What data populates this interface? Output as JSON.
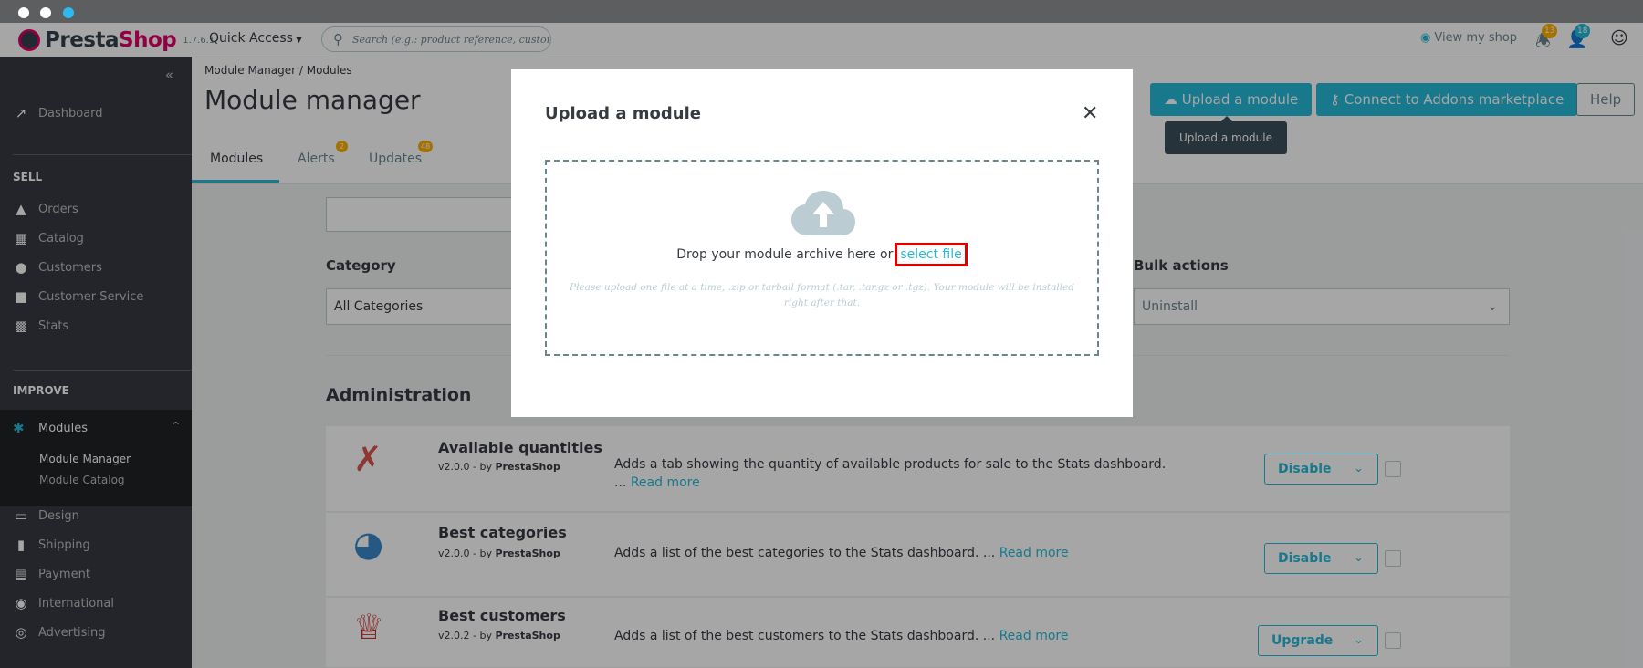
{
  "topbar": {
    "logo_name_part1": "Presta",
    "logo_name_part2": "Shop",
    "version": "1.7.6.1",
    "quick_access": "Quick Access",
    "search_placeholder": "Search (e.g.: product reference, customer name…)",
    "view_shop": "View my shop",
    "notif_orders_count": "13",
    "notif_customers_count": "18"
  },
  "sidebar": {
    "dashboard": "Dashboard",
    "sell_title": "SELL",
    "orders": "Orders",
    "catalog": "Catalog",
    "customers": "Customers",
    "customer_service": "Customer Service",
    "stats": "Stats",
    "improve_title": "IMPROVE",
    "modules": "Modules",
    "module_manager": "Module Manager",
    "module_catalog": "Module Catalog",
    "design": "Design",
    "shipping": "Shipping",
    "payment": "Payment",
    "international": "International",
    "advertising": "Advertising"
  },
  "header": {
    "breadcrumb_1": "Module Manager",
    "breadcrumb_2": "Modules",
    "title": "Module manager",
    "upload_btn": "Upload a module",
    "connect_btn": "Connect to Addons marketplace",
    "help_btn": "Help",
    "tooltip": "Upload a module",
    "tabs": [
      {
        "label": "Modules"
      },
      {
        "label": "Alerts",
        "badge": "2"
      },
      {
        "label": "Updates",
        "badge": "48"
      }
    ]
  },
  "filters": {
    "category_label": "Category",
    "category_value": "All Categories",
    "bulk_label": "Bulk actions",
    "bulk_value": "Uninstall"
  },
  "group_title": "Administration",
  "modules_list": [
    {
      "name": "Available quantities",
      "version": "v2.0.0 - by",
      "author": "PrestaShop",
      "desc": "Adds a tab showing the quantity of available products for sale to the Stats dashboard. ...",
      "read_more": "Read more",
      "action": "Disable"
    },
    {
      "name": "Best categories",
      "version": "v2.0.0 - by",
      "author": "PrestaShop",
      "desc": "Adds a list of the best categories to the Stats dashboard. ...",
      "read_more": "Read more",
      "action": "Disable"
    },
    {
      "name": "Best customers",
      "version": "v2.0.2 - by",
      "author": "PrestaShop",
      "desc": "Adds a list of the best customers to the Stats dashboard. ...",
      "read_more": "Read more",
      "action": "Upgrade"
    }
  ],
  "modal": {
    "title": "Upload a module",
    "drop_text": "Drop your module archive here or",
    "select_file": "select file",
    "hint": "Please upload one file at a time, .zip or tarball format (.tar, .tar.gz or .tgz). Your module will be installed right after that."
  },
  "colors": {
    "primary": "#25b9d7",
    "sidebar_bg": "#363a41",
    "brand_pink": "#df0067",
    "highlight_red": "#e00000"
  },
  "icons": {
    "close": "close-icon",
    "cloud_upload": "cloud-upload-icon"
  }
}
